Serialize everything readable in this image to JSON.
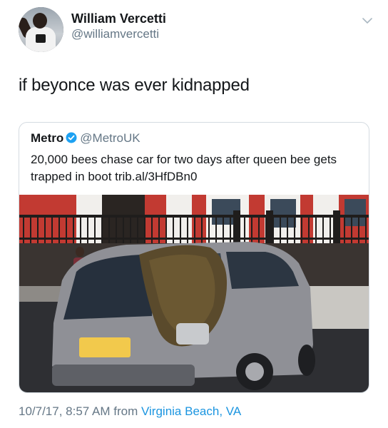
{
  "author": {
    "display_name": "William Vercetti",
    "handle": "@williamvercetti"
  },
  "tweet": {
    "text": "if beyonce was ever kidnapped"
  },
  "quoted_tweet": {
    "display_name": "Metro",
    "handle": "@MetroUK",
    "text": "20,000 bees chase car for two days after queen bee gets trapped in boot trib.al/3HfDBn0"
  },
  "footer": {
    "timestamp": "10/7/17, 8:57 AM from",
    "location": "Virginia Beach, VA"
  },
  "colors": {
    "link": "#1b95e0",
    "secondary_text": "#657786",
    "verified": "#1da1f2"
  },
  "icons": {
    "menu": "chevron-down-icon",
    "verified": "verified-badge-icon"
  }
}
